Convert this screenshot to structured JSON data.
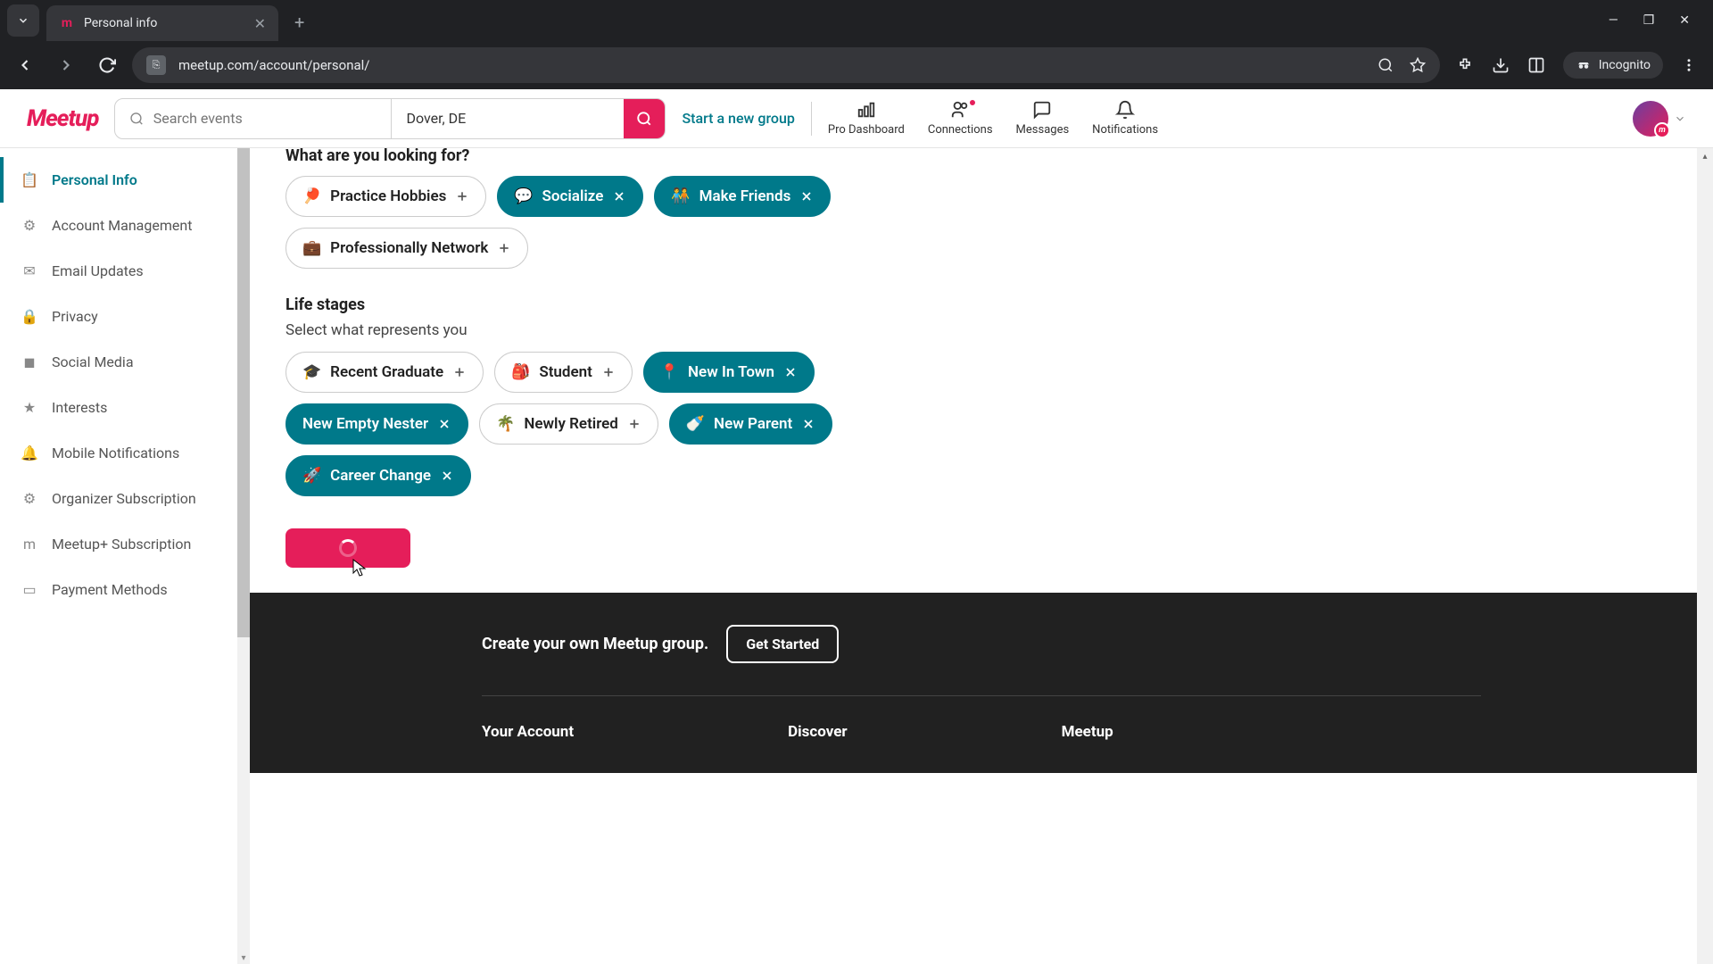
{
  "browser": {
    "tab_title": "Personal info",
    "url": "meetup.com/account/personal/",
    "incognito_label": "Incognito"
  },
  "header": {
    "logo": "Meetup",
    "search_placeholder": "Search events",
    "location": "Dover, DE",
    "start_group": "Start a new group",
    "nav": {
      "pro_dashboard": "Pro Dashboard",
      "connections": "Connections",
      "messages": "Messages",
      "notifications": "Notifications"
    }
  },
  "sidebar": {
    "items": [
      {
        "label": "Personal Info",
        "icon": "📋"
      },
      {
        "label": "Account Management",
        "icon": "⚙"
      },
      {
        "label": "Email Updates",
        "icon": "✉"
      },
      {
        "label": "Privacy",
        "icon": "🔒"
      },
      {
        "label": "Social Media",
        "icon": "◼"
      },
      {
        "label": "Interests",
        "icon": "★"
      },
      {
        "label": "Mobile Notifications",
        "icon": "🔔"
      },
      {
        "label": "Organizer Subscription",
        "icon": "⚙"
      },
      {
        "label": "Meetup+ Subscription",
        "icon": "m"
      },
      {
        "label": "Payment Methods",
        "icon": "▭"
      }
    ]
  },
  "content": {
    "looking_for_title": "What are you looking for?",
    "looking_for": [
      {
        "emoji": "🏓",
        "label": "Practice Hobbies",
        "selected": false
      },
      {
        "emoji": "💬",
        "label": "Socialize",
        "selected": true
      },
      {
        "emoji": "🧑‍🤝‍🧑",
        "label": "Make Friends",
        "selected": true
      },
      {
        "emoji": "💼",
        "label": "Professionally Network",
        "selected": false
      }
    ],
    "life_stages_title": "Life stages",
    "life_stages_subtitle": "Select what represents you",
    "life_stages": [
      {
        "emoji": "🎓",
        "label": "Recent Graduate",
        "selected": false
      },
      {
        "emoji": "🎒",
        "label": "Student",
        "selected": false
      },
      {
        "emoji": "📍",
        "label": "New In Town",
        "selected": true
      },
      {
        "emoji": "",
        "label": "New Empty Nester",
        "selected": true
      },
      {
        "emoji": "🌴",
        "label": "Newly Retired",
        "selected": false
      },
      {
        "emoji": "🍼",
        "label": "New Parent",
        "selected": true
      },
      {
        "emoji": "🚀",
        "label": "Career Change",
        "selected": true
      }
    ]
  },
  "footer": {
    "cta_text": "Create your own Meetup group.",
    "cta_button": "Get Started",
    "col1": "Your Account",
    "col2": "Discover",
    "col3": "Meetup"
  }
}
